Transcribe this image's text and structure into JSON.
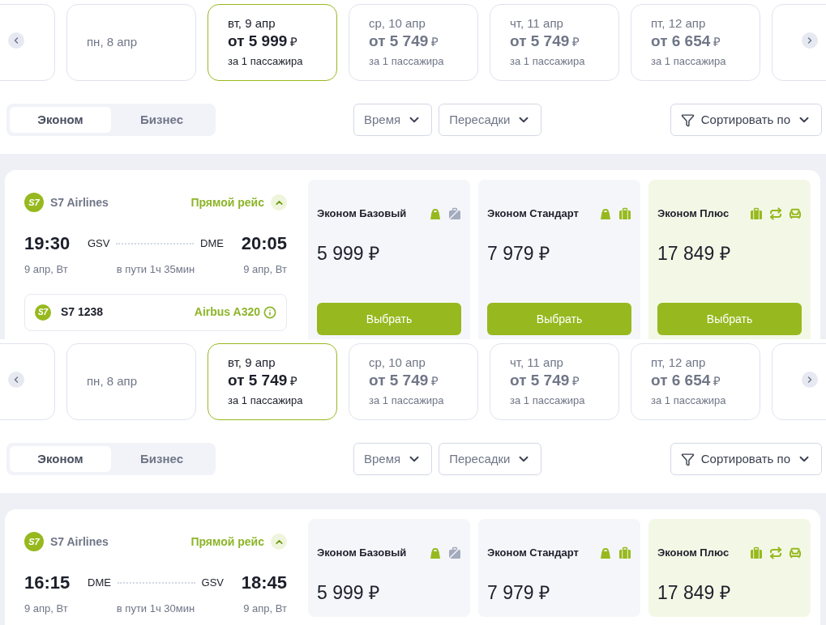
{
  "sections": [
    {
      "dates": [
        {
          "kind": "blank",
          "selected": false
        },
        {
          "kind": "plain",
          "label": "пн, 8 апр",
          "selected": false
        },
        {
          "kind": "priced",
          "label": "вт, 9 апр",
          "price": "от 5 999",
          "currency": "₽",
          "note": "за 1 пассажира",
          "selected": true
        },
        {
          "kind": "priced",
          "label": "ср, 10 апр",
          "price": "от 5 749",
          "currency": "₽",
          "note": "за 1 пассажира",
          "selected": false
        },
        {
          "kind": "priced",
          "label": "чт, 11 апр",
          "price": "от 5 749",
          "currency": "₽",
          "note": "за 1 пассажира",
          "selected": false
        },
        {
          "kind": "priced",
          "label": "пт, 12 апр",
          "price": "от 6 654",
          "currency": "₽",
          "note": "за 1 пассажира",
          "selected": false
        },
        {
          "kind": "blank",
          "selected": false
        }
      ],
      "classes": [
        {
          "label": "Эконом",
          "selected": true
        },
        {
          "label": "Бизнес",
          "selected": false
        }
      ],
      "filters": [
        "Время",
        "Пересадки"
      ],
      "sort": "Сортировать по",
      "flight": {
        "logo_text": "S7",
        "airline": "S7 Airlines",
        "direct": "Прямой рейс",
        "expanded": true,
        "depart_time": "19:30",
        "from": "GSV",
        "to": "DME",
        "arrive_time": "20:05",
        "depart_date": "9 апр, Вт",
        "duration": "в пути 1ч 35мин",
        "arrive_date": "9 апр, Вт",
        "number_logo_text": "S7",
        "number": "S7 1238",
        "aircraft": "Airbus A320",
        "fares": [
          {
            "name": "Эконом Базовый",
            "price": "5 999 ₽",
            "highlighted": false,
            "button": "Выбрать",
            "features": [
              {
                "kind": "hand-bag",
                "included": true
              },
              {
                "kind": "suitcase",
                "included": false
              }
            ]
          },
          {
            "name": "Эконом Стандарт",
            "price": "7 979 ₽",
            "highlighted": false,
            "button": "Выбрать",
            "features": [
              {
                "kind": "hand-bag",
                "included": true
              },
              {
                "kind": "suitcase",
                "included": true
              }
            ]
          },
          {
            "name": "Эконом Плюс",
            "price": "17 849 ₽",
            "highlighted": true,
            "button": "Выбрать",
            "features": [
              {
                "kind": "suitcase",
                "included": true
              },
              {
                "kind": "exchange",
                "included": true
              },
              {
                "kind": "seat",
                "included": true
              }
            ]
          }
        ]
      }
    },
    {
      "dates": [
        {
          "kind": "blank",
          "selected": false
        },
        {
          "kind": "plain",
          "label": "пн, 8 апр",
          "selected": false
        },
        {
          "kind": "priced",
          "label": "вт, 9 апр",
          "price": "от 5 749",
          "currency": "₽",
          "note": "за 1 пассажира",
          "selected": true
        },
        {
          "kind": "priced",
          "label": "ср, 10 апр",
          "price": "от 5 749",
          "currency": "₽",
          "note": "за 1 пассажира",
          "selected": false
        },
        {
          "kind": "priced",
          "label": "чт, 11 апр",
          "price": "от 5 749",
          "currency": "₽",
          "note": "за 1 пассажира",
          "selected": false
        },
        {
          "kind": "priced",
          "label": "пт, 12 апр",
          "price": "от 6 654",
          "currency": "₽",
          "note": "за 1 пассажира",
          "selected": false
        },
        {
          "kind": "blank",
          "selected": false
        }
      ],
      "classes": [
        {
          "label": "Эконом",
          "selected": true
        },
        {
          "label": "Бизнес",
          "selected": false
        }
      ],
      "filters": [
        "Время",
        "Пересадки"
      ],
      "sort": "Сортировать по",
      "flight": {
        "logo_text": "S7",
        "airline": "S7 Airlines",
        "direct": "Прямой рейс",
        "expanded": true,
        "depart_time": "16:15",
        "from": "DME",
        "to": "GSV",
        "arrive_time": "18:45",
        "depart_date": "9 апр, Вт",
        "duration": "в пути 1ч 30мин",
        "arrive_date": "9 апр, Вт",
        "fares": [
          {
            "name": "Эконом Базовый",
            "price": "5 999 ₽",
            "highlighted": false,
            "features": [
              {
                "kind": "hand-bag",
                "included": true
              },
              {
                "kind": "suitcase",
                "included": false
              }
            ]
          },
          {
            "name": "Эконом Стандарт",
            "price": "7 979 ₽",
            "highlighted": false,
            "features": [
              {
                "kind": "hand-bag",
                "included": true
              },
              {
                "kind": "suitcase",
                "included": true
              }
            ]
          },
          {
            "name": "Эконом Плюс",
            "price": "17 849 ₽",
            "highlighted": true,
            "features": [
              {
                "kind": "suitcase",
                "included": true
              },
              {
                "kind": "exchange",
                "included": true
              },
              {
                "kind": "seat",
                "included": true
              }
            ]
          }
        ]
      }
    }
  ]
}
